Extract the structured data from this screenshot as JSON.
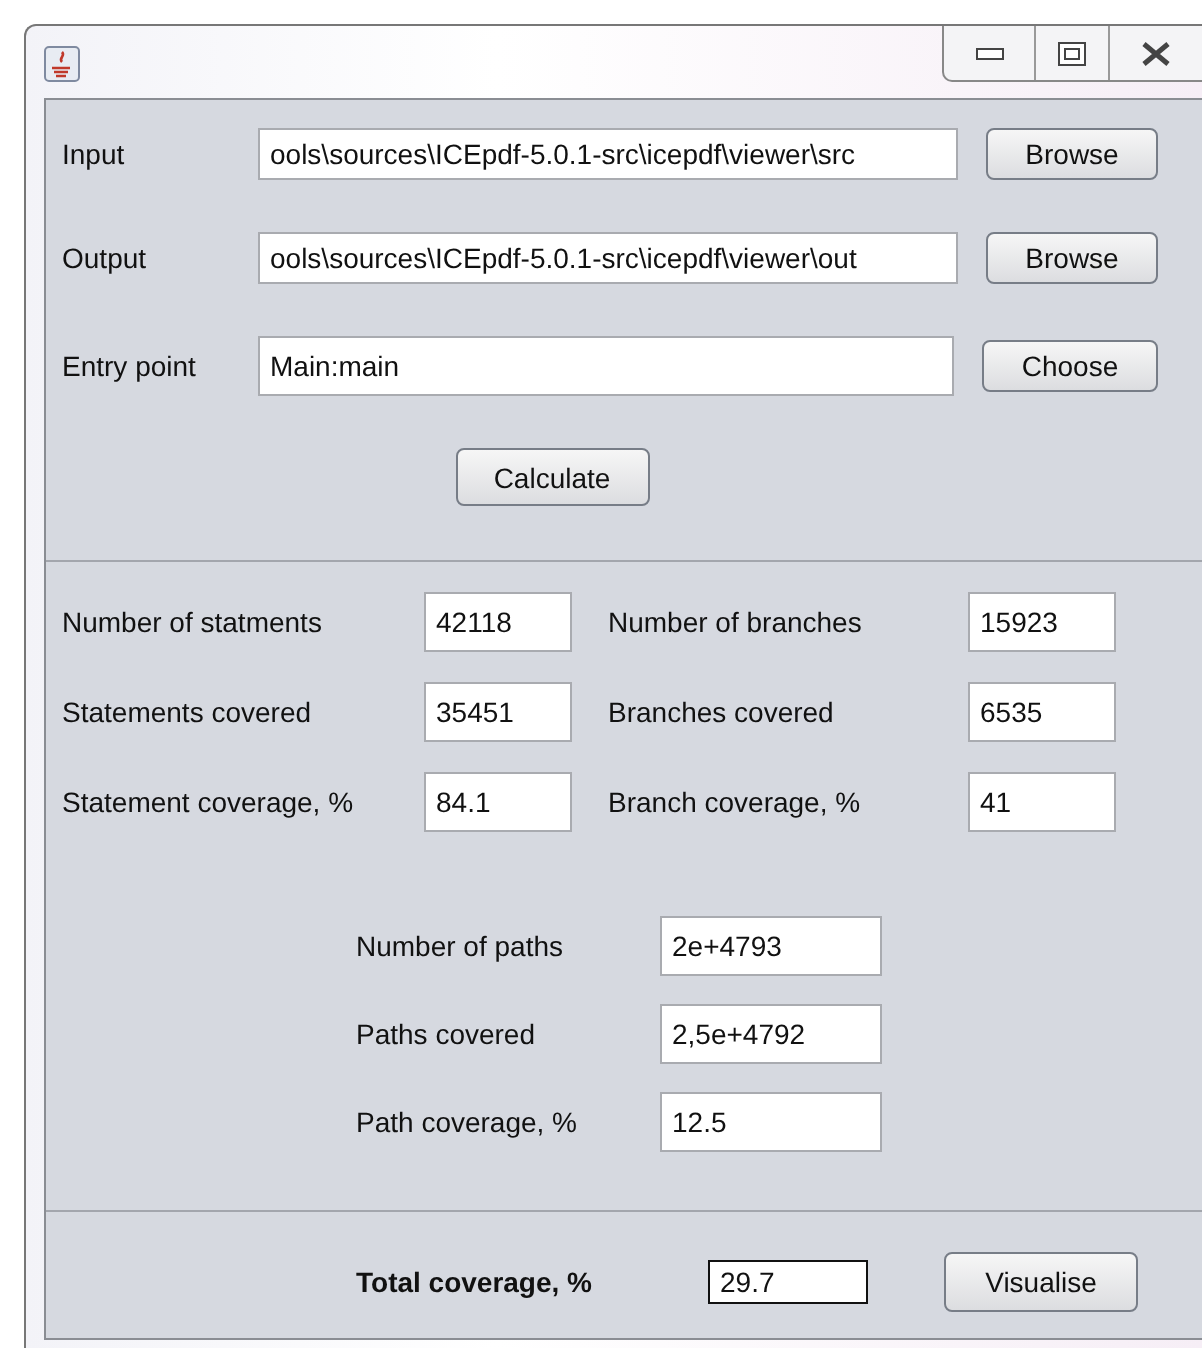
{
  "paths": [
    {
      "label": "Input",
      "value": "ools\\sources\\ICEpdf-5.0.1-src\\icepdf\\viewer\\src",
      "button": "Browse"
    },
    {
      "label": "Output",
      "value": "ools\\sources\\ICEpdf-5.0.1-src\\icepdf\\viewer\\out",
      "button": "Browse"
    },
    {
      "label": "Entry point",
      "value": "Main:main",
      "button": "Choose"
    }
  ],
  "calculate_button": "Calculate",
  "statistics": [
    {
      "label": "Number of statments",
      "value": "42118"
    },
    {
      "label": "Number of branches",
      "value": "15923"
    },
    {
      "label": "Statements covered",
      "value": "35451"
    },
    {
      "label": "Branches covered",
      "value": "6535"
    },
    {
      "label": "Statement coverage, %",
      "value": "84.1"
    },
    {
      "label": "Branch coverage, %",
      "value": "41"
    }
  ],
  "path_statistics": [
    {
      "label": "Number of paths",
      "value": "2e+4793"
    },
    {
      "label": "Paths covered",
      "value": "2,5e+4792"
    },
    {
      "label": "Path coverage, %",
      "value": "12.5"
    }
  ],
  "total": {
    "label": "Total coverage, %",
    "value": "29.7",
    "button": "Visualise"
  }
}
